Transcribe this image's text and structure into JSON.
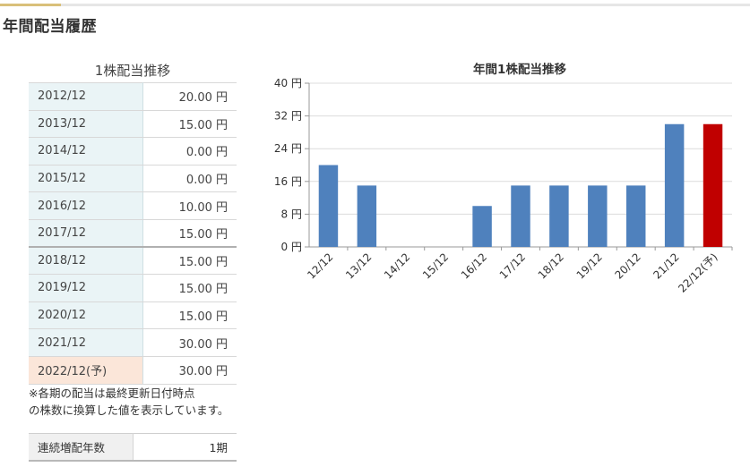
{
  "header": {
    "title": "年間配当履歴"
  },
  "dividend_table": {
    "caption": "1株配当推移",
    "rows": [
      {
        "year": "2012/12",
        "value": "20.00 円"
      },
      {
        "year": "2013/12",
        "value": "15.00 円"
      },
      {
        "year": "2014/12",
        "value": "0.00 円"
      },
      {
        "year": "2015/12",
        "value": "0.00 円"
      },
      {
        "year": "2016/12",
        "value": "10.00 円"
      },
      {
        "year": "2017/12",
        "value": "15.00 円"
      },
      {
        "year": "2018/12",
        "value": "15.00 円"
      },
      {
        "year": "2019/12",
        "value": "15.00 円"
      },
      {
        "year": "2020/12",
        "value": "15.00 円"
      },
      {
        "year": "2021/12",
        "value": "30.00 円"
      },
      {
        "year": "2022/12(予)",
        "value": "30.00 円"
      }
    ],
    "note_line1": "※各期の配当は最終更新日付時点",
    "note_line2": "の株数に換算した値を表示しています。"
  },
  "streak": {
    "label": "連続増配年数",
    "value": "1期"
  },
  "colors": {
    "bar": "#4f81bd",
    "forecast_bar": "#c00000",
    "accent": "#d9c07a"
  },
  "chart_data": {
    "type": "bar",
    "title": "年間1株配当推移",
    "categories": [
      "12/12",
      "13/12",
      "14/12",
      "15/12",
      "16/12",
      "17/12",
      "18/12",
      "19/12",
      "20/12",
      "21/12",
      "22/12(予)"
    ],
    "values": [
      20,
      15,
      0,
      0,
      10,
      15,
      15,
      15,
      15,
      30,
      30
    ],
    "forecast_index": 10,
    "y_ticks": [
      "0 円",
      "8 円",
      "16 円",
      "24 円",
      "32 円",
      "40 円"
    ],
    "ylim": [
      0,
      40
    ],
    "grid": true
  }
}
